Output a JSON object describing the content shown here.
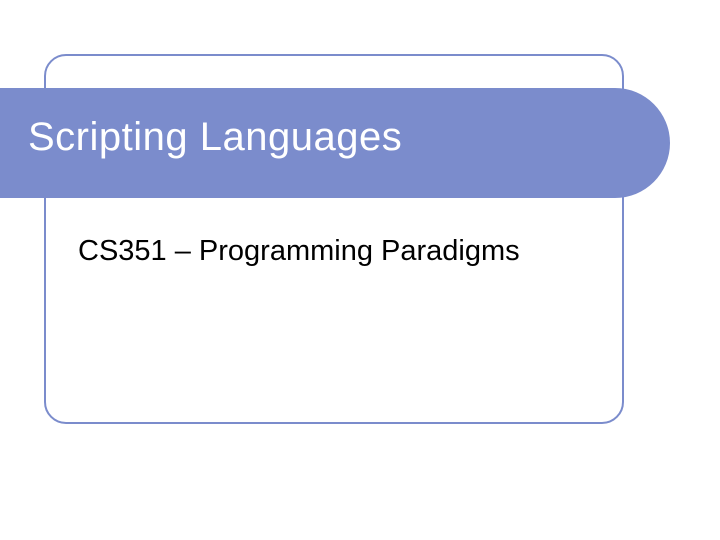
{
  "slide": {
    "title": "Scripting Languages",
    "subtitle": "CS351 – Programming Paradigms"
  },
  "colors": {
    "accent": "#7b8ccc",
    "title_text": "#ffffff",
    "body_text": "#000000"
  }
}
